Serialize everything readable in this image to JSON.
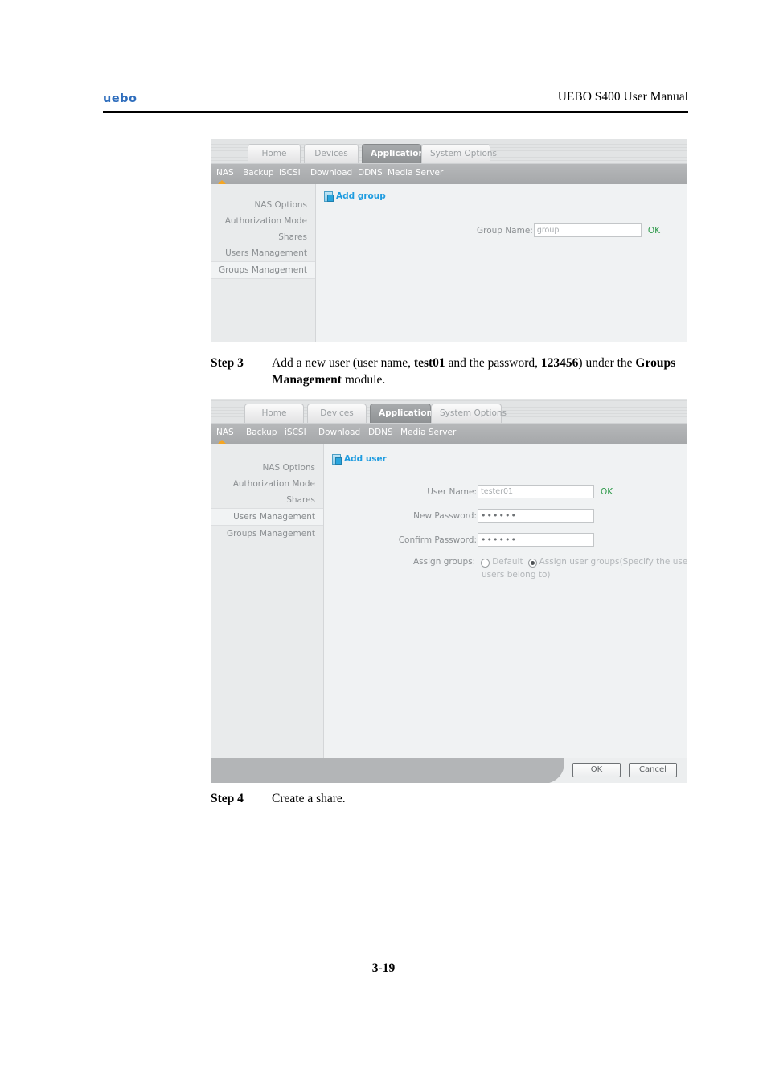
{
  "document": {
    "logo": "uebo",
    "header_title": "UEBO S400 User Manual",
    "page_number": "3-19"
  },
  "steps": {
    "step3": {
      "label": "Step 3",
      "text_1": "Add a new user (user name, ",
      "bold_1": "test01",
      "text_2": " and the password, ",
      "bold_2": "123456",
      "text_3": ") under the ",
      "bold_3": "Groups Management",
      "text_4": " module."
    },
    "step4": {
      "label": "Step 4",
      "text": "Create a share."
    }
  },
  "screenshot1": {
    "tabs": [
      {
        "label": "Home",
        "active": false
      },
      {
        "label": "Devices",
        "active": false
      },
      {
        "label": "Applications",
        "active": true
      },
      {
        "label": "System Options",
        "active": false
      }
    ],
    "subnav": [
      {
        "label": "NAS",
        "active": true
      },
      {
        "label": "Backup",
        "active": false
      },
      {
        "label": "iSCSI",
        "active": false
      },
      {
        "label": "Download",
        "active": false
      },
      {
        "label": "DDNS",
        "active": false
      },
      {
        "label": "Media Server",
        "active": false
      }
    ],
    "sidebar": [
      {
        "label": "NAS Options",
        "selected": false
      },
      {
        "label": "Authorization Mode",
        "selected": false
      },
      {
        "label": "Shares",
        "selected": false
      },
      {
        "label": "Users Management",
        "selected": false
      },
      {
        "label": "Groups Management",
        "selected": true
      }
    ],
    "add_link": "Add group",
    "form": {
      "group_name_label": "Group Name:",
      "group_name_value": "group",
      "ok_label": "OK"
    },
    "colors": {
      "link": "#1f9ce0",
      "ok": "#2e9a4a",
      "active_marker": "#f5a623"
    }
  },
  "screenshot2": {
    "tabs": [
      {
        "label": "Home",
        "active": false
      },
      {
        "label": "Devices",
        "active": false
      },
      {
        "label": "Applications",
        "active": true
      },
      {
        "label": "System Options",
        "active": false
      }
    ],
    "subnav": [
      {
        "label": "NAS",
        "active": true
      },
      {
        "label": "Backup",
        "active": false
      },
      {
        "label": "iSCSI",
        "active": false
      },
      {
        "label": "Download",
        "active": false
      },
      {
        "label": "DDNS",
        "active": false
      },
      {
        "label": "Media Server",
        "active": false
      }
    ],
    "sidebar": [
      {
        "label": "NAS Options",
        "selected": false
      },
      {
        "label": "Authorization Mode",
        "selected": false
      },
      {
        "label": "Shares",
        "selected": false
      },
      {
        "label": "Users Management",
        "selected": true
      },
      {
        "label": "Groups Management",
        "selected": false
      }
    ],
    "add_link": "Add user",
    "form": {
      "user_name_label": "User Name:",
      "user_name_value": "tester01",
      "ok_label": "OK",
      "new_password_label": "New Password:",
      "new_password_value": "••••••",
      "confirm_password_label": "Confirm Password:",
      "confirm_password_value": "••••••",
      "assign_groups_label": "Assign groups:",
      "radio_default_label": "Default",
      "radio_assign_label": "Assign user groups(Specify the user groups",
      "radio_assign_label_line2": "users belong to)"
    },
    "footer": {
      "ok_button": "OK",
      "cancel_button": "Cancel"
    }
  }
}
